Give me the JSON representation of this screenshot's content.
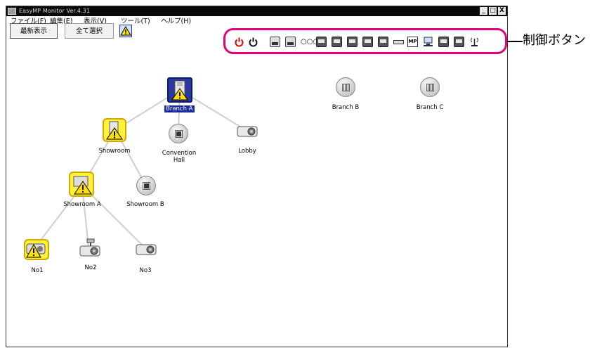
{
  "window": {
    "title": "EasyMP Monitor Ver.4.31",
    "buttons": [
      "_",
      "□",
      "X"
    ]
  },
  "menu": [
    "ファイル(F)",
    "編集(E)",
    "表示(V)",
    "ツール(T)",
    "ヘルプ(H)"
  ],
  "toolbar": {
    "refresh_label": "最新表示",
    "select_all_label": "全て選択"
  },
  "control_group_label": "制御ボタン",
  "control_buttons": [
    "power-on",
    "power-off",
    "input-computer1",
    "input-computer2",
    "input-video",
    "input-s-video",
    "input-easymp",
    "input-hdmi",
    "input-dvi",
    "input-computer-2",
    "av-mute",
    "mp",
    "network",
    "source1",
    "source2",
    "antenna"
  ],
  "tree": {
    "nodes": [
      {
        "id": "branch_a",
        "label": "Branch A",
        "icon": "building-warning",
        "selected": true
      },
      {
        "id": "branch_b",
        "label": "Branch B",
        "icon": "building"
      },
      {
        "id": "branch_c",
        "label": "Branch C",
        "icon": "building"
      },
      {
        "id": "showroom",
        "label": "Showroom",
        "icon": "building-warning"
      },
      {
        "id": "convention_hall",
        "label": "Convention\nHall",
        "icon": "group"
      },
      {
        "id": "lobby",
        "label": "Lobby",
        "icon": "projector"
      },
      {
        "id": "showroom_a",
        "label": "Showroom A",
        "icon": "group-warning"
      },
      {
        "id": "showroom_b",
        "label": "Showroom B",
        "icon": "group"
      },
      {
        "id": "no1",
        "label": "No1",
        "icon": "projector-warning"
      },
      {
        "id": "no2",
        "label": "No2",
        "icon": "projector-ceiling"
      },
      {
        "id": "no3",
        "label": "No3",
        "icon": "projector"
      }
    ]
  },
  "colors": {
    "highlight": "#e6007e",
    "selection": "#1a2c9c",
    "warning": "#fff23a",
    "titlebar": "#0a0a0a"
  }
}
